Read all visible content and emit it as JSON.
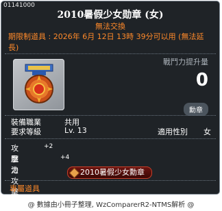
{
  "item": {
    "id": "01141000",
    "title": "2010暑假少女勋章 (女)",
    "untradable": "無法交換",
    "expiry": "期限制道具 : 2026年 6月 12日 13時 39分可以用 (無法延長)"
  },
  "combat_power": {
    "label": "戰鬥力提升量",
    "value": "0"
  },
  "medal_tag": "勳章",
  "requirements": {
    "job_label": "裝備職業",
    "job_value": "共用",
    "level_label": "要求等級",
    "level_value": "Lv. 13",
    "gender_label": "適用性別",
    "gender_value": "女"
  },
  "stats": [
    {
      "name": "攻擊力",
      "value": "+2"
    },
    {
      "name": "魔法攻擊力",
      "value": "+4"
    }
  ],
  "medal_banner": "2010暑假少女勳章",
  "exclusive_label": "專屬道具",
  "footer": "@ 數據由小冊子整理, WzComparerR2-NTMS解析 @",
  "colors": {
    "background": "#1f2327",
    "border": "#7d8893",
    "orange": "#ff8a2a",
    "banner": "#6a1410"
  }
}
